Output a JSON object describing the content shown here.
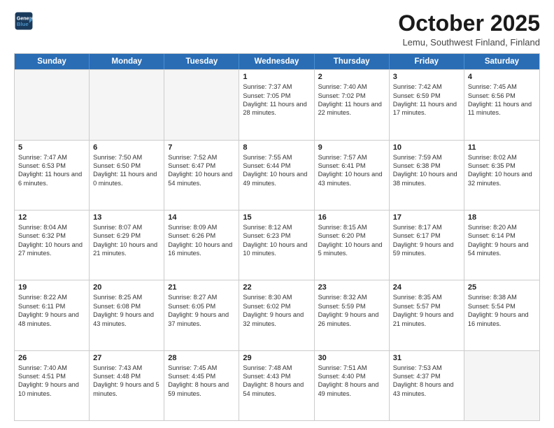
{
  "header": {
    "logo_line1": "General",
    "logo_line2": "Blue",
    "month": "October 2025",
    "location": "Lemu, Southwest Finland, Finland"
  },
  "days_of_week": [
    "Sunday",
    "Monday",
    "Tuesday",
    "Wednesday",
    "Thursday",
    "Friday",
    "Saturday"
  ],
  "weeks": [
    [
      {
        "day": "",
        "info": ""
      },
      {
        "day": "",
        "info": ""
      },
      {
        "day": "",
        "info": ""
      },
      {
        "day": "1",
        "info": "Sunrise: 7:37 AM\nSunset: 7:05 PM\nDaylight: 11 hours\nand 28 minutes."
      },
      {
        "day": "2",
        "info": "Sunrise: 7:40 AM\nSunset: 7:02 PM\nDaylight: 11 hours\nand 22 minutes."
      },
      {
        "day": "3",
        "info": "Sunrise: 7:42 AM\nSunset: 6:59 PM\nDaylight: 11 hours\nand 17 minutes."
      },
      {
        "day": "4",
        "info": "Sunrise: 7:45 AM\nSunset: 6:56 PM\nDaylight: 11 hours\nand 11 minutes."
      }
    ],
    [
      {
        "day": "5",
        "info": "Sunrise: 7:47 AM\nSunset: 6:53 PM\nDaylight: 11 hours\nand 6 minutes."
      },
      {
        "day": "6",
        "info": "Sunrise: 7:50 AM\nSunset: 6:50 PM\nDaylight: 11 hours\nand 0 minutes."
      },
      {
        "day": "7",
        "info": "Sunrise: 7:52 AM\nSunset: 6:47 PM\nDaylight: 10 hours\nand 54 minutes."
      },
      {
        "day": "8",
        "info": "Sunrise: 7:55 AM\nSunset: 6:44 PM\nDaylight: 10 hours\nand 49 minutes."
      },
      {
        "day": "9",
        "info": "Sunrise: 7:57 AM\nSunset: 6:41 PM\nDaylight: 10 hours\nand 43 minutes."
      },
      {
        "day": "10",
        "info": "Sunrise: 7:59 AM\nSunset: 6:38 PM\nDaylight: 10 hours\nand 38 minutes."
      },
      {
        "day": "11",
        "info": "Sunrise: 8:02 AM\nSunset: 6:35 PM\nDaylight: 10 hours\nand 32 minutes."
      }
    ],
    [
      {
        "day": "12",
        "info": "Sunrise: 8:04 AM\nSunset: 6:32 PM\nDaylight: 10 hours\nand 27 minutes."
      },
      {
        "day": "13",
        "info": "Sunrise: 8:07 AM\nSunset: 6:29 PM\nDaylight: 10 hours\nand 21 minutes."
      },
      {
        "day": "14",
        "info": "Sunrise: 8:09 AM\nSunset: 6:26 PM\nDaylight: 10 hours\nand 16 minutes."
      },
      {
        "day": "15",
        "info": "Sunrise: 8:12 AM\nSunset: 6:23 PM\nDaylight: 10 hours\nand 10 minutes."
      },
      {
        "day": "16",
        "info": "Sunrise: 8:15 AM\nSunset: 6:20 PM\nDaylight: 10 hours\nand 5 minutes."
      },
      {
        "day": "17",
        "info": "Sunrise: 8:17 AM\nSunset: 6:17 PM\nDaylight: 9 hours\nand 59 minutes."
      },
      {
        "day": "18",
        "info": "Sunrise: 8:20 AM\nSunset: 6:14 PM\nDaylight: 9 hours\nand 54 minutes."
      }
    ],
    [
      {
        "day": "19",
        "info": "Sunrise: 8:22 AM\nSunset: 6:11 PM\nDaylight: 9 hours\nand 48 minutes."
      },
      {
        "day": "20",
        "info": "Sunrise: 8:25 AM\nSunset: 6:08 PM\nDaylight: 9 hours\nand 43 minutes."
      },
      {
        "day": "21",
        "info": "Sunrise: 8:27 AM\nSunset: 6:05 PM\nDaylight: 9 hours\nand 37 minutes."
      },
      {
        "day": "22",
        "info": "Sunrise: 8:30 AM\nSunset: 6:02 PM\nDaylight: 9 hours\nand 32 minutes."
      },
      {
        "day": "23",
        "info": "Sunrise: 8:32 AM\nSunset: 5:59 PM\nDaylight: 9 hours\nand 26 minutes."
      },
      {
        "day": "24",
        "info": "Sunrise: 8:35 AM\nSunset: 5:57 PM\nDaylight: 9 hours\nand 21 minutes."
      },
      {
        "day": "25",
        "info": "Sunrise: 8:38 AM\nSunset: 5:54 PM\nDaylight: 9 hours\nand 16 minutes."
      }
    ],
    [
      {
        "day": "26",
        "info": "Sunrise: 7:40 AM\nSunset: 4:51 PM\nDaylight: 9 hours\nand 10 minutes."
      },
      {
        "day": "27",
        "info": "Sunrise: 7:43 AM\nSunset: 4:48 PM\nDaylight: 9 hours\nand 5 minutes."
      },
      {
        "day": "28",
        "info": "Sunrise: 7:45 AM\nSunset: 4:45 PM\nDaylight: 8 hours\nand 59 minutes."
      },
      {
        "day": "29",
        "info": "Sunrise: 7:48 AM\nSunset: 4:43 PM\nDaylight: 8 hours\nand 54 minutes."
      },
      {
        "day": "30",
        "info": "Sunrise: 7:51 AM\nSunset: 4:40 PM\nDaylight: 8 hours\nand 49 minutes."
      },
      {
        "day": "31",
        "info": "Sunrise: 7:53 AM\nSunset: 4:37 PM\nDaylight: 8 hours\nand 43 minutes."
      },
      {
        "day": "",
        "info": ""
      }
    ]
  ]
}
